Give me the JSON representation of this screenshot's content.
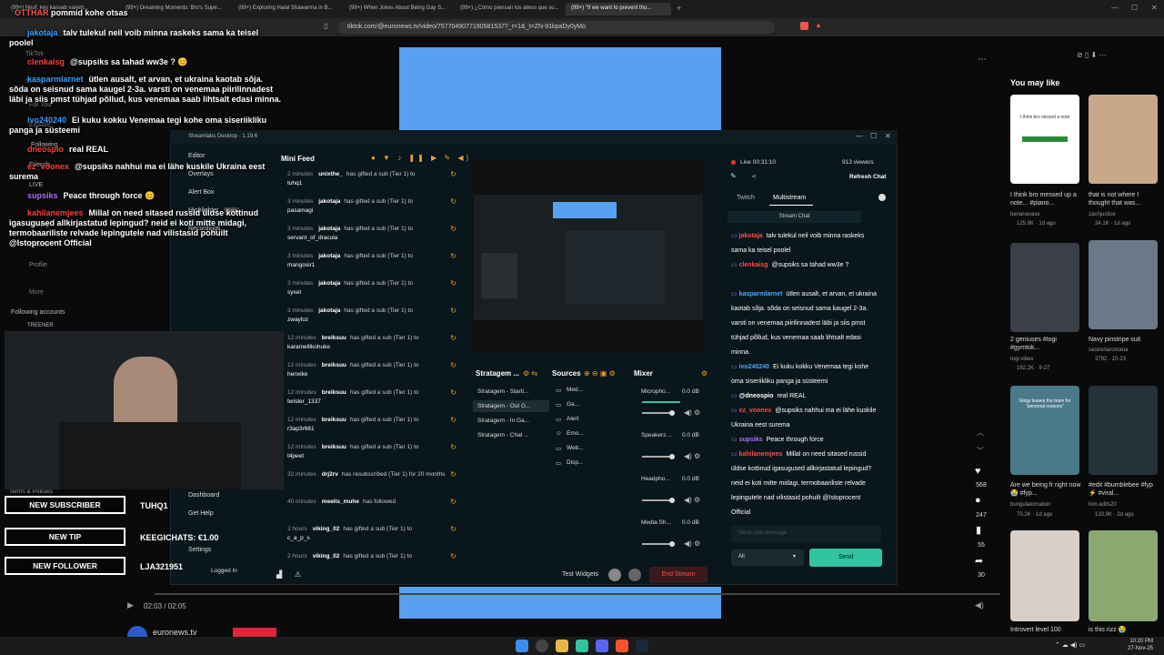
{
  "browser": {
    "tabs": [
      "(99+) Neuf, kes kasvab varem...",
      "(99+) Dreaming Moments: Bro's Supe...",
      "(99+) Exploring Halal Shawarma in B...",
      "(99+) When Jokes About Being Gay S...",
      "(99+) ¿Cómo piensan los ateos que su...",
      "(99+) \"If we want to prevent tho..."
    ],
    "url": "tiktok.com/@euronews.tv/video/7577049077190581537?_r=1&_t=ZN-91kpaDy0yMo"
  },
  "tiktok": {
    "sidebar": [
      "For You",
      "Explore",
      "Following",
      "Friends",
      "LIVE",
      "Activity",
      "Upload",
      "Profile",
      "More"
    ],
    "search_label": "Search",
    "following_accounts": "Following accounts",
    "footer": "Terms & Policies",
    "you_may_like": "You may like",
    "timecode": "02:03 / 02:05",
    "channel": "euronews.tv",
    "actions": {
      "likes": "568",
      "comments": "247",
      "saves": "55",
      "shares": "30"
    },
    "thumbs": [
      {
        "caption": "I think bro messed up a note... #piano...",
        "user": "bananavase",
        "meta": "125.9K · 1d ago",
        "overlay": "I think bro missed a note"
      },
      {
        "caption": "that is not where I thought that was...",
        "user": "zachjustice",
        "meta": "34.1K · 1d ago"
      },
      {
        "caption": "2 geniuses #togi #gymtok...",
        "user": "togi.vibes",
        "meta": "192.2K · 9-27"
      },
      {
        "caption": "Navy pinstripe suit",
        "user": "sastrerlaromana",
        "meta": "3792 · 10-23"
      },
      {
        "caption": "Are we being fr right now 😭 #fyp...",
        "user": "bungulatomation",
        "meta": "70.2K · 1d ago",
        "overlay": "Gingy leaves the team for \"personal reasons\""
      },
      {
        "caption": "#edit #bumblebee #fyp ⚡ #viral...",
        "user": "him.edits20",
        "meta": "133.9K · 2d ago"
      },
      {
        "caption": "Introvert level 100",
        "user": "",
        "meta": ""
      },
      {
        "caption": "is this rizz 😭",
        "user": "",
        "meta": ""
      }
    ]
  },
  "overlay_chat": [
    {
      "name": "jakotaja",
      "text": "talv tulekul neil voib minna raskeks sama ka teisel poolel",
      "color": "#3aa0ff"
    },
    {
      "name": "clenkaisg",
      "text": "@supsiks sa tahad ww3e ? 😊",
      "color": "#ff4040"
    },
    {
      "name": "kasparmlarnet",
      "text": "ütlen ausalt, et arvan, et ukraina kaotab sõja. sõda on seisnud sama kaugel 2-3a. varsti on venemaa piirilinnadest läbi ja siis pmst tühjad põllud, kus venemaa saab lihtsalt edasi minna.",
      "color": "#3aa0ff"
    },
    {
      "name": "ivo240240",
      "text": "Ei kuku kokku Venemaa tegi kohe oma siseriikliku panga ja süsteemi",
      "color": "#3aa0ff"
    },
    {
      "name": "dneospio",
      "text": "real REAL",
      "color": "#ff4040"
    },
    {
      "name": "ez_voonex",
      "text": "@supsiks nahhui ma ei lähe kuskile Ukraina eest surema",
      "color": "#ff4040"
    },
    {
      "name": "supsiks",
      "text": "Peace through force 😊",
      "color": "#b070ff"
    },
    {
      "name": "kahilanemjees",
      "text": "Millal on need sitased russid üldse kottinud igasugused allkirjastatud lepingud? neid ei koti mitte midagi, termobaariliste relvade lepingutele nad vilistasid pohuilt @Istoprocent Official",
      "color": "#ff4040"
    }
  ],
  "overlay_top_name": "pommid kohe otsas",
  "alerts": [
    {
      "label": "NEW SUBSCRIBER",
      "value": "TUHQ1"
    },
    {
      "label": "NEW TIP",
      "value": "KEEGICHATS: €1.00"
    },
    {
      "label": "NEW FOLLOWER",
      "value": "LJA321951"
    }
  ],
  "streamlabs": {
    "title": "Streamlabs Desktop - 1.19.6",
    "nav": [
      "Editor",
      "Overlays",
      "Alert Box",
      "Highlighter",
      "Recordings"
    ],
    "beta": "Beta",
    "nav_bottom": [
      "Dashboard",
      "Get Help",
      "Settings"
    ],
    "logged_in": "Logged In",
    "mini_feed_title": "Mini Feed",
    "feed": [
      {
        "time": "2 minutes",
        "user": "unixthe_",
        "action": "has gifted a sub (Tier 1) to",
        "target": "tuhq1"
      },
      {
        "time": "3 minutes",
        "user": "jakotaja",
        "action": "has gifted a sub (Tier 1) to",
        "target": "pasamagi"
      },
      {
        "time": "3 minutes",
        "user": "jakotaja",
        "action": "has gifted a sub (Tier 1) to",
        "target": "servant_of_dracula"
      },
      {
        "time": "3 minutes",
        "user": "jakotaja",
        "action": "has gifted a sub (Tier 1) to",
        "target": "mangosir1"
      },
      {
        "time": "3 minutes",
        "user": "jakotaja",
        "action": "has gifted a sub (Tier 1) to",
        "target": "syxet"
      },
      {
        "time": "3 minutes",
        "user": "jakotaja",
        "action": "has gifted a sub (Tier 1) to",
        "target": "zwayloz"
      },
      {
        "time": "12 minutes",
        "user": "breiksuu",
        "action": "has gifted a sub (Tier 1) to",
        "target": "karamellikohuke"
      },
      {
        "time": "12 minutes",
        "user": "breiksuu",
        "action": "has gifted a sub (Tier 1) to",
        "target": "henxike"
      },
      {
        "time": "12 minutes",
        "user": "breiksuu",
        "action": "has gifted a sub (Tier 1) to",
        "target": "twister_1337"
      },
      {
        "time": "12 minutes",
        "user": "breiksuu",
        "action": "has gifted a sub (Tier 1) to",
        "target": "r3ap3r661"
      },
      {
        "time": "12 minutes",
        "user": "breiksuu",
        "action": "has gifted a sub (Tier 1) to",
        "target": "t4peet"
      },
      {
        "time": "32 minutes",
        "user": "drj2rv",
        "action": "has resubscribed (Tier 1) for 20 months",
        "target": ""
      },
      {
        "time": "40 minutes",
        "user": "meelis_muhe",
        "action": "has followed",
        "target": ""
      },
      {
        "time": "2 hours",
        "user": "viking_02",
        "action": "has gifted a sub (Tier 1) to",
        "target": "c_a_p_s"
      },
      {
        "time": "2 hours",
        "user": "viking_02",
        "action": "has gifted a sub (Tier 1) to",
        "target": ""
      }
    ],
    "scenes_title": "Stratagem ...",
    "scenes": [
      "Stratagem - Starti...",
      "Stratagem - Out G...",
      "Stratagem - In Ga...",
      "Stratagem - Chat ..."
    ],
    "sources_title": "Sources",
    "sources": [
      "Med...",
      "Ga...",
      "Alert",
      "Emo...",
      "Web...",
      "Disp..."
    ],
    "mixer_title": "Mixer",
    "mixer": [
      {
        "name": "Micropho...",
        "db": "0.0 dB"
      },
      {
        "name": "Speakers ...",
        "db": "0.0 dB"
      },
      {
        "name": "Headpho...",
        "db": "0.0 dB"
      },
      {
        "name": "Media Sh...",
        "db": "0.0 dB"
      }
    ],
    "test_widgets": "Test Widgets",
    "end_stream": "End Stream",
    "live_time": "Live 00:31:10",
    "viewers": "913 viewers",
    "refresh_chat": "Refresh Chat",
    "tab_twitch": "Twitch",
    "tab_multistream": "Multistream",
    "stream_chat": "Stream Chat",
    "chat_placeholder": "Send chat message",
    "chat_filter": "All",
    "send": "Send"
  },
  "panel_chat": [
    {
      "user": "jakotaja",
      "text": "talv tulekul neil voib minna raskeks sama ka teisel poolel",
      "color": "#ff4a4a"
    },
    {
      "user": "clenkaisg",
      "text": "@supsiks sa tahad ww3e ?",
      "color": "#ff4a4a"
    },
    {
      "user": "kasparmlarnet",
      "text": "ütlen ausalt, et arvan, et ukraina kaotab sõja. sõda on seisnud sama kaugel 2-3a. varsti on venemaa piirilinnadest läbi ja siis pmst tühjad põllud, kus venemaa saab lihtsalt edasi minna.",
      "color": "#4aa8ff"
    },
    {
      "user": "ivo240240",
      "text": "Ei kuku kokku Venemaa tegi kohe oma siseriikliku panga ja süsteemi",
      "color": "#4aa8ff"
    },
    {
      "user": "@dneospio",
      "text": "real REAL",
      "color": "#ffffff"
    },
    {
      "user": "ez_voonex",
      "text": "@supsiks nahhui ma ei lähe kuskile Ukraina eest surema",
      "color": "#ff4a4a"
    },
    {
      "user": "supsiks",
      "text": "Peace through force",
      "color": "#b070ff"
    },
    {
      "user": "kahilanemjees",
      "text": "Millal on need sitased russid üldse kottinud igasugused allkirjastatud lepingud? neid ei koti mitte midagi, termobaariliste relvade lepingutele nad vilistasid pohuilt @Istoprocent Official",
      "color": "#ff4a4a"
    }
  ],
  "clock": {
    "time": "10:20 PM",
    "date": "27-Nov-25"
  },
  "colors": {
    "accent": "#31c3a2",
    "end_stream": "#ff4a4a",
    "video_blue": "#58a0f0"
  }
}
